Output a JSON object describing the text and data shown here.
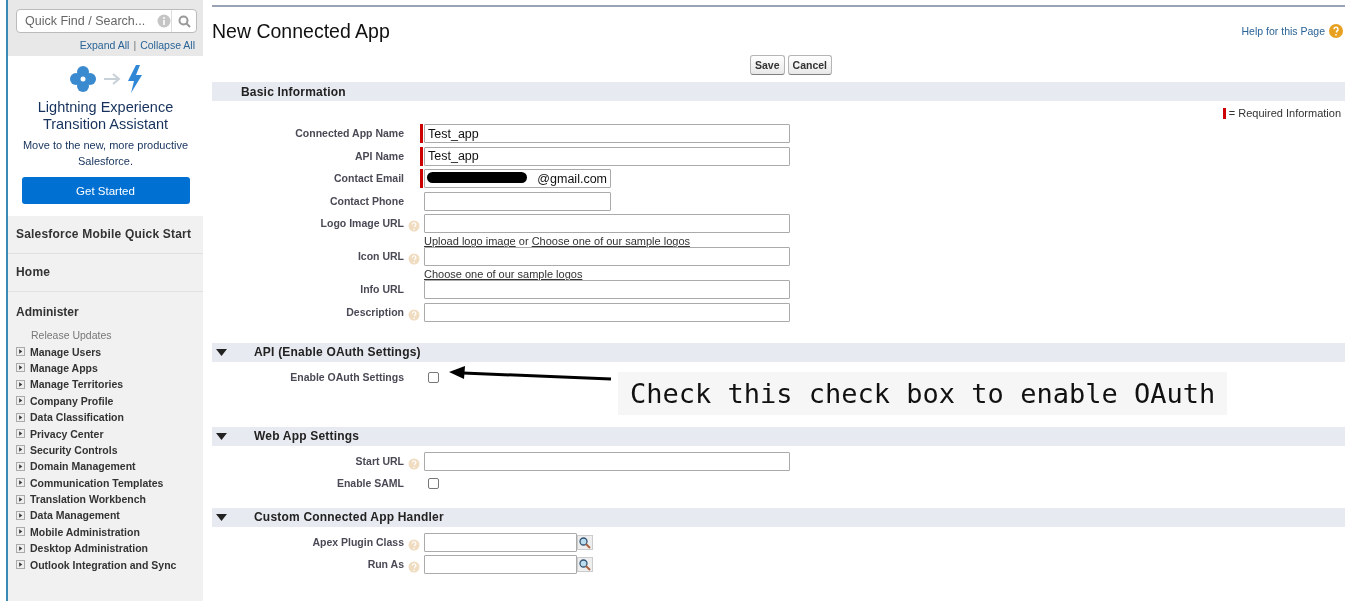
{
  "sidebar": {
    "search": {
      "placeholder": "Quick Find / Search..."
    },
    "expand_all": "Expand All",
    "link_separator": "|",
    "collapse_all": "Collapse All",
    "promo": {
      "title": "Lightning Experience Transition Assistant",
      "text": "Move to the new, more productive Salesforce.",
      "button": "Get Started"
    },
    "links": [
      {
        "label": "Salesforce Mobile Quick Start"
      },
      {
        "label": "Home"
      }
    ],
    "group": {
      "label": "Administer",
      "items": [
        {
          "label": "Release Updates",
          "expandable": false
        },
        {
          "label": "Manage Users",
          "expandable": true
        },
        {
          "label": "Manage Apps",
          "expandable": true
        },
        {
          "label": "Manage Territories",
          "expandable": true
        },
        {
          "label": "Company Profile",
          "expandable": true
        },
        {
          "label": "Data Classification",
          "expandable": true
        },
        {
          "label": "Privacy Center",
          "expandable": true
        },
        {
          "label": "Security Controls",
          "expandable": true
        },
        {
          "label": "Domain Management",
          "expandable": true
        },
        {
          "label": "Communication Templates",
          "expandable": true
        },
        {
          "label": "Translation Workbench",
          "expandable": true
        },
        {
          "label": "Data Management",
          "expandable": true
        },
        {
          "label": "Mobile Administration",
          "expandable": true
        },
        {
          "label": "Desktop Administration",
          "expandable": true
        },
        {
          "label": "Outlook Integration and Sync",
          "expandable": true
        }
      ]
    }
  },
  "page": {
    "title": "New Connected App",
    "help": "Help for this Page",
    "buttons": [
      "Save",
      "Cancel"
    ],
    "required_legend": "= Required Information",
    "sections": [
      {
        "title": "Basic Information",
        "collapsible": false,
        "fields": [
          {
            "label": "Connected App Name",
            "kind": "text",
            "required": true,
            "help": false,
            "value": "Test_app"
          },
          {
            "label": "API Name",
            "kind": "text",
            "required": true,
            "help": false,
            "value": "Test_app"
          },
          {
            "label": "Contact Email",
            "kind": "short",
            "required": true,
            "help": false,
            "value": "@gmail.com",
            "redacted": true
          },
          {
            "label": "Contact Phone",
            "kind": "short",
            "required": false,
            "help": false
          },
          {
            "label": "Logo Image URL",
            "kind": "text",
            "required": false,
            "help": true,
            "links": [
              "Upload logo image",
              "or",
              "Choose one of our sample logos"
            ]
          },
          {
            "label": "Icon URL",
            "kind": "text",
            "required": false,
            "help": true,
            "links": [
              "Choose one of our sample logos"
            ]
          },
          {
            "label": "Info URL",
            "kind": "text",
            "required": false,
            "help": false
          },
          {
            "label": "Description",
            "kind": "text",
            "required": false,
            "help": true
          }
        ]
      },
      {
        "title": "API (Enable OAuth Settings)",
        "collapsible": true,
        "expanded": true,
        "fields": [
          {
            "label": "Enable OAuth Settings",
            "kind": "checkbox",
            "required": false,
            "help": false,
            "checked": false,
            "annotation": "Check this check box to enable OAuth"
          }
        ]
      },
      {
        "title": "Web App Settings",
        "collapsible": true,
        "expanded": true,
        "fields": [
          {
            "label": "Start URL",
            "kind": "text",
            "required": false,
            "help": true
          },
          {
            "label": "Enable SAML",
            "kind": "checkbox",
            "required": false,
            "help": false,
            "checked": false
          }
        ]
      },
      {
        "title": "Custom Connected App Handler",
        "collapsible": true,
        "expanded": true,
        "fields": [
          {
            "label": "Apex Plugin Class",
            "kind": "lookup",
            "required": false,
            "help": true
          },
          {
            "label": "Run As",
            "kind": "lookup",
            "required": false,
            "help": true
          }
        ]
      }
    ]
  }
}
